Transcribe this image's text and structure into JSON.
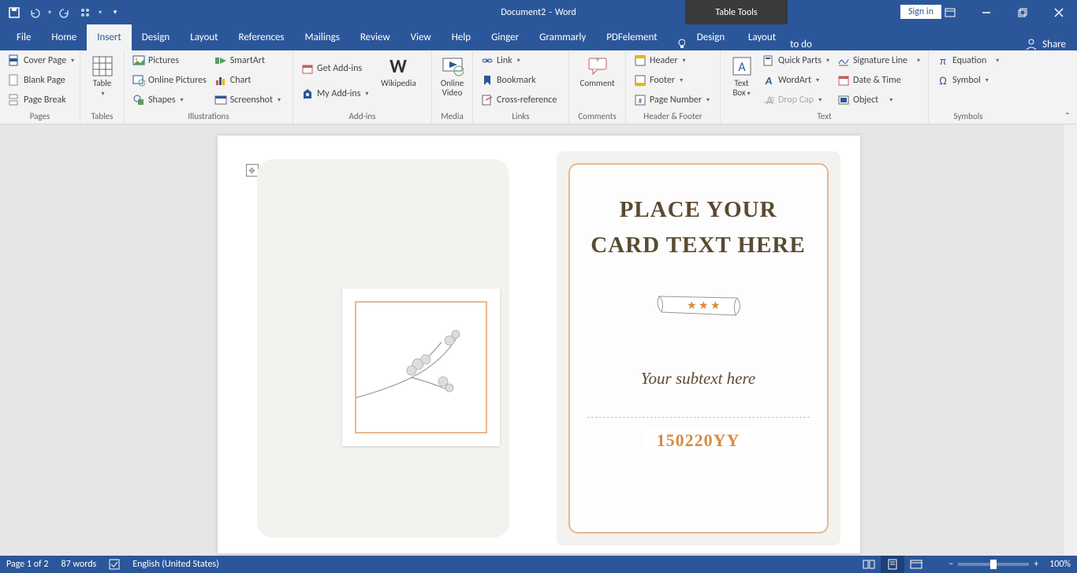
{
  "title": {
    "doc": "Document2",
    "sep": " - ",
    "app": "Word",
    "tools": "Table Tools"
  },
  "account": {
    "signin": "Sign in"
  },
  "tabs": [
    "File",
    "Home",
    "Insert",
    "Design",
    "Layout",
    "References",
    "Mailings",
    "Review",
    "View",
    "Help",
    "Ginger",
    "Grammarly",
    "PDFelement"
  ],
  "subtabs": [
    "Design",
    "Layout"
  ],
  "active_tab": "Insert",
  "tellme": "Tell me what you want to do",
  "share": "Share",
  "ribbon": {
    "pages": {
      "label": "Pages",
      "cover": "Cover Page",
      "blank": "Blank Page",
      "break": "Page Break"
    },
    "tables": {
      "label": "Tables",
      "table": "Table"
    },
    "illustrations": {
      "label": "Illustrations",
      "pictures": "Pictures",
      "online": "Online Pictures",
      "shapes": "Shapes",
      "smartart": "SmartArt",
      "chart": "Chart",
      "screenshot": "Screenshot"
    },
    "addins": {
      "label": "Add-ins",
      "get": "Get Add-ins",
      "my": "My Add-ins",
      "wiki": "Wikipedia"
    },
    "media": {
      "label": "Media",
      "online_video": "Online\nVideo"
    },
    "links": {
      "label": "Links",
      "link": "Link",
      "bookmark": "Bookmark",
      "xref": "Cross-reference"
    },
    "comments": {
      "label": "Comments",
      "comment": "Comment"
    },
    "hf": {
      "label": "Header & Footer",
      "header": "Header",
      "footer": "Footer",
      "pagenum": "Page Number"
    },
    "text": {
      "label": "Text",
      "textbox": "Text\nBox",
      "quick": "Quick Parts",
      "wordart": "WordArt",
      "dropcap": "Drop Cap",
      "sig": "Signature Line",
      "dt": "Date & Time",
      "object": "Object"
    },
    "symbols": {
      "label": "Symbols",
      "eq": "Equation",
      "sym": "Symbol"
    }
  },
  "card": {
    "title": "PLACE YOUR CARD TEXT HERE",
    "subtext": "Your subtext here",
    "code": "150220YY"
  },
  "status": {
    "page": "Page 1 of 2",
    "words": "87 words",
    "lang": "English (United States)",
    "zoom": "100%"
  }
}
